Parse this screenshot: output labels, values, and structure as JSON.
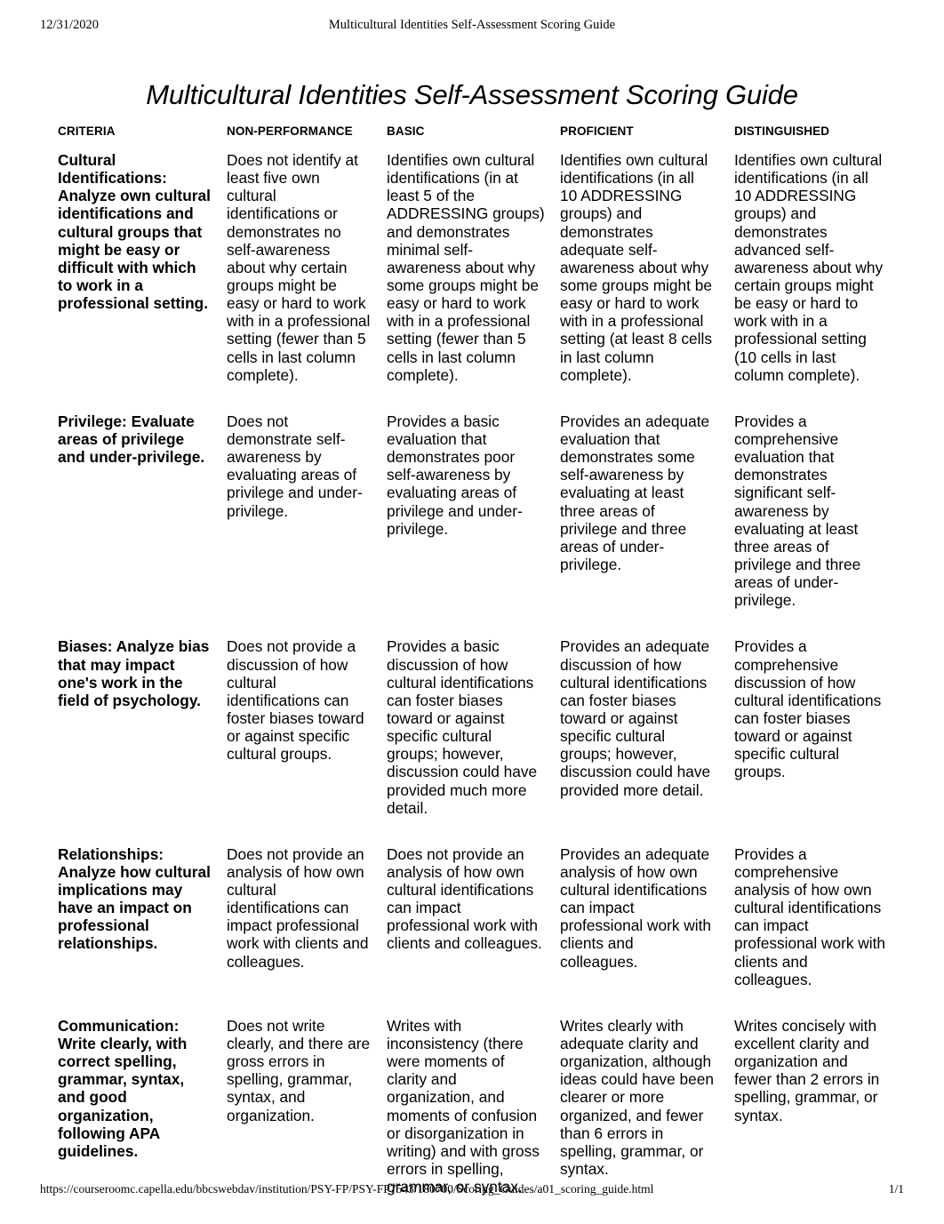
{
  "print_header": {
    "date": "12/31/2020",
    "title": "Multicultural Identities Self-Assessment Scoring Guide"
  },
  "document": {
    "title": "Multicultural Identities Self-Assessment Scoring Guide"
  },
  "rubric": {
    "columns": [
      {
        "key": "criteria",
        "label": "CRITERIA"
      },
      {
        "key": "non_performance",
        "label": "NON-PERFORMANCE"
      },
      {
        "key": "basic",
        "label": "BASIC"
      },
      {
        "key": "proficient",
        "label": "PROFICIENT"
      },
      {
        "key": "distinguished",
        "label": "DISTINGUISHED"
      }
    ],
    "rows": [
      {
        "criteria": "Cultural Identifications: Analyze own cultural identifications and cultural groups that might be easy or difficult with which to work in a professional setting.",
        "non_performance": "Does not identify at least five own cultural identifications or demonstrates no self-awareness about why certain groups might be easy or hard to work with in a professional setting (fewer than 5 cells in last column complete).",
        "basic": "Identifies own cultural identifications (in at least 5 of the ADDRESSING groups) and demonstrates minimal self-awareness about why some groups might be easy or hard to work with in a professional setting (fewer than 5 cells in last column complete).",
        "proficient": "Identifies own cultural identifications (in all 10 ADDRESSING groups) and demonstrates adequate self-awareness about why some groups might be easy or hard to work with in a professional setting (at least 8 cells in last column complete).",
        "distinguished": "Identifies own cultural identifications (in all 10 ADDRESSING groups) and demonstrates advanced self-awareness about why certain groups might be easy or hard to work with in a professional setting (10 cells in last column complete)."
      },
      {
        "criteria": "Privilege: Evaluate areas of privilege and under-privilege.",
        "non_performance": "Does not demonstrate self-awareness by evaluating areas of privilege and under-privilege.",
        "basic": "Provides a basic evaluation that demonstrates poor self-awareness by evaluating areas of privilege and under-privilege.",
        "proficient": "Provides an adequate evaluation that demonstrates some self-awareness by evaluating at least three areas of privilege and three areas of under-privilege.",
        "distinguished": "Provides a comprehensive evaluation that demonstrates significant self-awareness by evaluating at least three areas of privilege and three areas of under-privilege."
      },
      {
        "criteria": "Biases: Analyze bias that may impact one's work in the field of psychology.",
        "non_performance": "Does not provide a discussion of how cultural identifications can foster biases toward or against specific cultural groups.",
        "basic": "Provides a basic discussion of how cultural identifications can foster biases toward or against specific cultural groups; however, discussion could have provided much more detail.",
        "proficient": "Provides an adequate discussion of how cultural identifications can foster biases toward or against specific cultural groups; however, discussion could have provided more detail.",
        "distinguished": "Provides a comprehensive discussion of how cultural identifications can foster biases toward or against specific cultural groups."
      },
      {
        "criteria": "Relationships: Analyze how cultural implications may have an impact on professional relationships.",
        "non_performance": "Does not provide an analysis of how own cultural identifications can impact professional work with clients and colleagues.",
        "basic": "Does not provide an analysis of how own cultural identifications can impact professional work with clients and colleagues.",
        "proficient": "Provides an adequate analysis of how own cultural identifications can impact professional work with clients and colleagues.",
        "distinguished": "Provides a comprehensive analysis of how own cultural identifications can impact professional work with clients and colleagues."
      },
      {
        "criteria": "Communication: Write clearly, with correct spelling, grammar, syntax, and good organization, following APA guidelines.",
        "non_performance": "Does not write clearly, and there are gross errors in spelling, grammar, syntax, and organization.",
        "basic": "Writes with inconsistency (there were moments of clarity and organization, and moments of confusion or disorganization in writing) and with gross errors in spelling, grammar, or syntax.",
        "proficient": "Writes clearly with adequate clarity and organization, although ideas could have been clearer or more organized, and fewer than 6 errors in spelling, grammar, or syntax.",
        "distinguished": "Writes concisely with excellent clarity and organization and fewer than 2 errors in spelling, grammar, or syntax."
      }
    ]
  },
  "print_footer": {
    "url": "https://courseroomc.capella.edu/bbcswebdav/institution/PSY-FP/PSY-FP7543/180700/Scoring_Guides/a01_scoring_guide.html",
    "page": "1/1"
  }
}
